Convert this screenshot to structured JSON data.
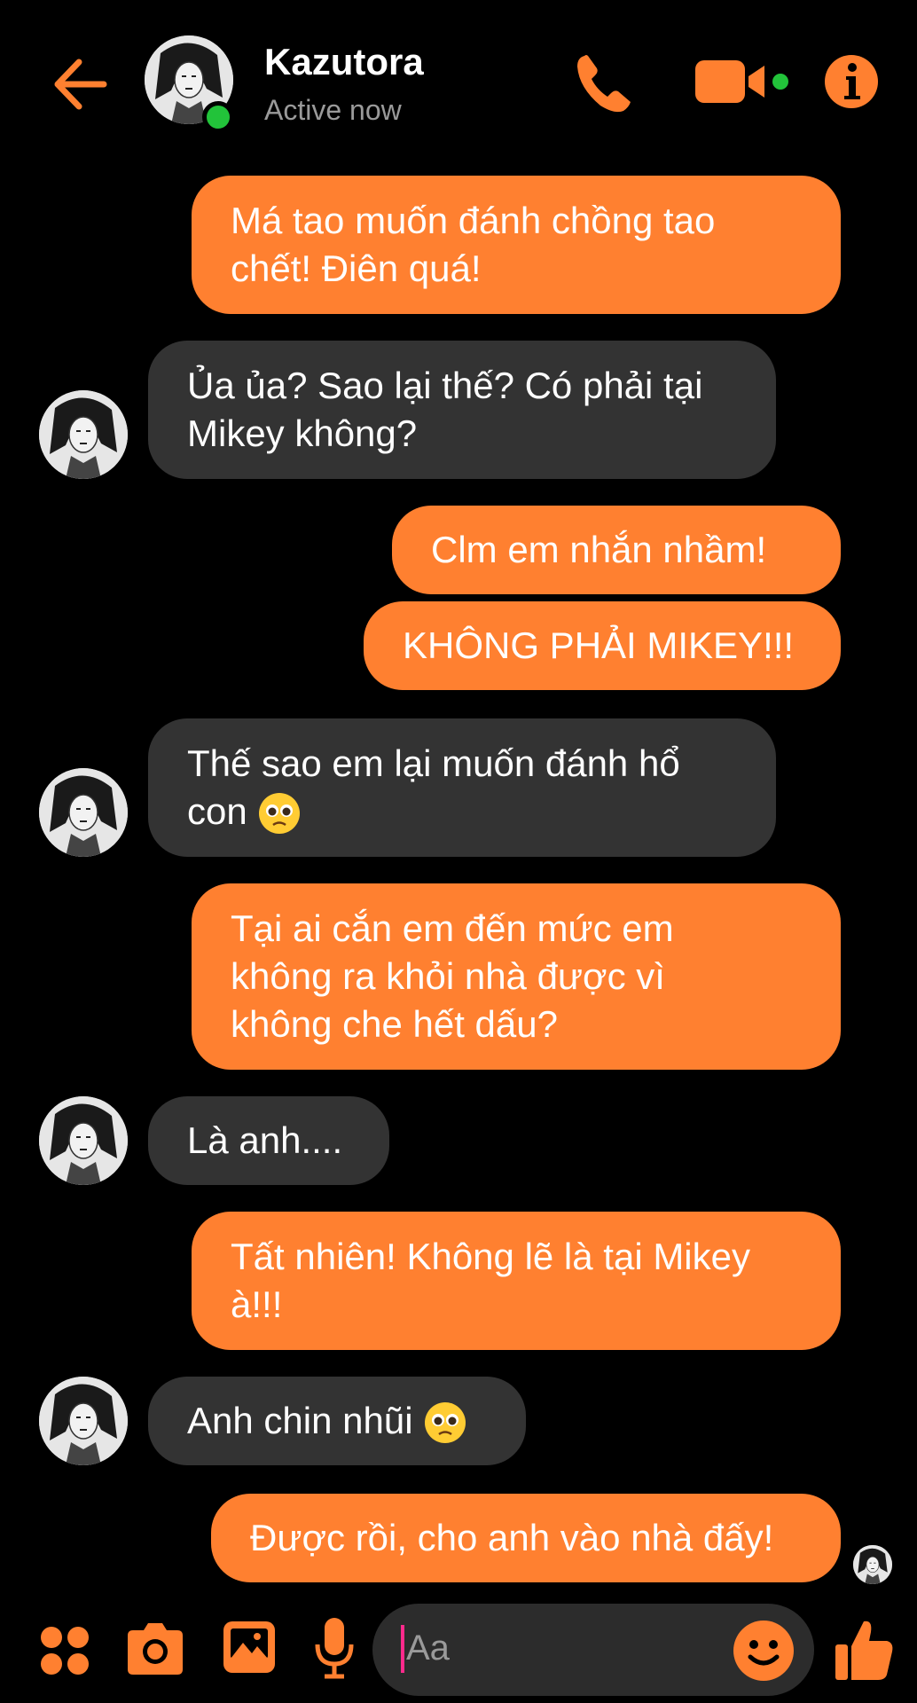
{
  "header": {
    "name": "Kazutora",
    "status": "Active now"
  },
  "icons": {
    "back": "arrow-left-icon",
    "call": "phone-icon",
    "video": "video-camera-icon",
    "info": "info-icon",
    "menu": "four-dots-icon",
    "camera": "camera-icon",
    "gallery": "image-icon",
    "mic": "microphone-icon",
    "emoji": "smiley-icon",
    "like": "thumbs-up-icon"
  },
  "colors": {
    "accent": "#ff8030",
    "incoming_bubble": "#333333",
    "background": "#000000",
    "online": "#22c33a"
  },
  "messages": [
    {
      "from": "me",
      "line1": "Má tao muốn đánh chồng tao",
      "line2": "chết! Điên quá!"
    },
    {
      "from": "them",
      "line1": "Ủa ủa? Sao lại thế? Có phải tại",
      "line2": "Mikey không?"
    },
    {
      "from": "me",
      "line1": "Clm em nhắn nhầm!"
    },
    {
      "from": "me",
      "line1": "KHÔNG PHẢI MIKEY!!!"
    },
    {
      "from": "them",
      "line1": "Thế sao em lại muốn đánh hổ",
      "line2": "con",
      "emoji": "pleading-face-emoji"
    },
    {
      "from": "me",
      "line1": "Tại ai cắn em đến mức em",
      "line2": "không ra khỏi nhà được vì",
      "line3": "không che hết dấu?"
    },
    {
      "from": "them",
      "line1": "Là anh...."
    },
    {
      "from": "me",
      "line1": "Tất nhiên! Không lẽ là tại Mikey",
      "line2": "à!!!"
    },
    {
      "from": "them",
      "line1": "Anh chin nhũi",
      "emoji": "pleading-face-emoji"
    },
    {
      "from": "me",
      "line1": "Được rồi, cho anh vào nhà đấy!"
    }
  ],
  "composer": {
    "placeholder": "Aa"
  }
}
